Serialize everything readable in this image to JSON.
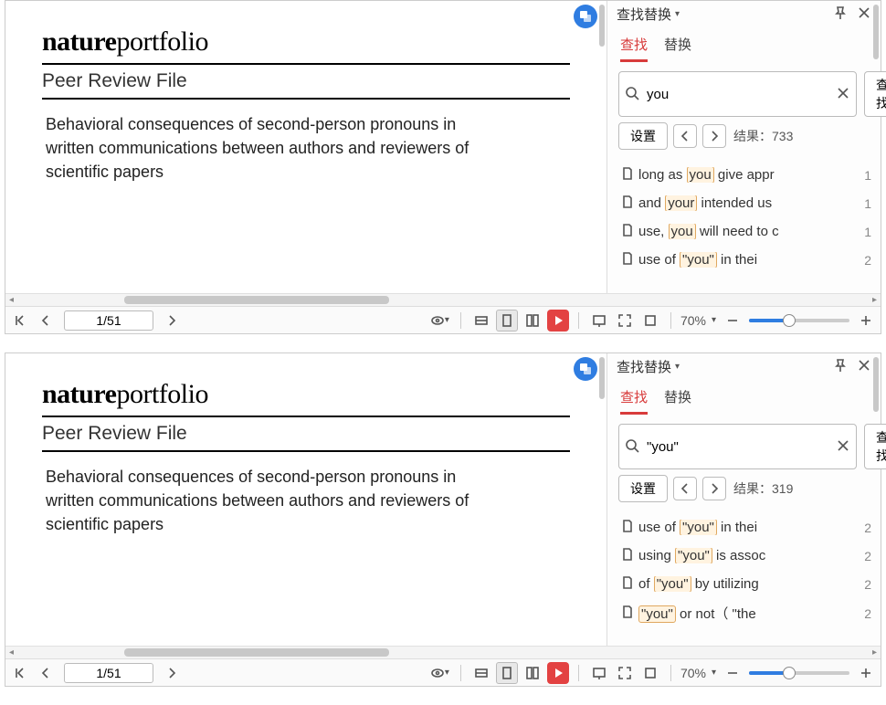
{
  "brand": {
    "bold": "nature",
    "light": "portfolio"
  },
  "section_title": "Peer Review File",
  "paper_title": "Behavioral consequences of second-person pronouns in written communications between authors and reviewers of scientific papers",
  "panel_title": "查找替换",
  "tabs": {
    "find": "查找",
    "replace": "替换"
  },
  "search_button_label": "查找",
  "settings_button_label": "设置",
  "results_prefix": "结果：",
  "page_indicator": "1/51",
  "zoom_label": "70%",
  "viewers": [
    {
      "search_value": "you",
      "result_count": "733",
      "zoom_fill_pct": 40,
      "results": [
        {
          "pre": "long as ",
          "hl": "you",
          "post": " give appr",
          "page": "1"
        },
        {
          "pre": "and ",
          "hl": "your",
          "post": " intended us",
          "page": "1"
        },
        {
          "pre": "use, ",
          "hl": "you",
          "post": " will need to c",
          "page": "1"
        },
        {
          "pre": "use of   ",
          "hl": "\"you\"",
          "post": "   in thei",
          "page": "2"
        }
      ]
    },
    {
      "search_value": "\"you\"",
      "result_count": "319",
      "zoom_fill_pct": 40,
      "results": [
        {
          "pre": "use of   ",
          "hl": "\"you\"",
          "post": "  in thei",
          "page": "2"
        },
        {
          "pre": "using   ",
          "hl": "\"you\"",
          "post": "  is assoc",
          "page": "2"
        },
        {
          "pre": "of   ",
          "hl": "\"you\"",
          "post": "  by utilizing",
          "page": "2"
        },
        {
          "pre": "",
          "hl": "\"you\"",
          "post": "  or not（ \"the",
          "page": "2"
        }
      ]
    }
  ]
}
